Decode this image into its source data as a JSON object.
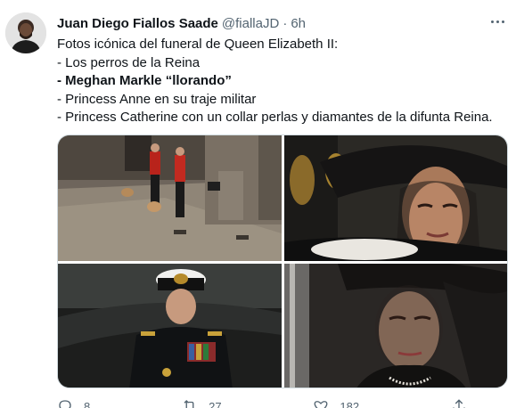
{
  "tweet": {
    "display_name": "Juan Diego Fiallos Saade",
    "handle": "@fiallaJD",
    "separator": "·",
    "time": "6h",
    "lines": [
      "Fotos icónica del funeral de Queen Elizabeth II:",
      "- Los perros de la Reina",
      "- Meghan Markle “llorando”",
      "- Princess Anne en su traje militar",
      "- Princess Catherine con un collar perlas y diamantes de la difunta Reina."
    ],
    "bold_line_index": 2,
    "actions": {
      "reply_count": "8",
      "retweet_count": "27",
      "like_count": "182"
    }
  },
  "colors": {
    "text": "#0f1419",
    "secondary": "#536471",
    "border": "#cfd9de"
  }
}
